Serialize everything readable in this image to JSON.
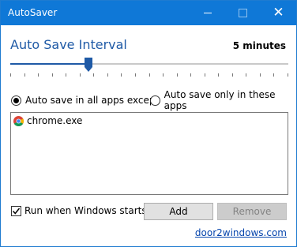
{
  "window": {
    "title": "AutoSaver",
    "controls": {
      "minimize_icon": "minimize-icon",
      "maximize_icon": "maximize-icon",
      "close_icon": "close-icon",
      "close_glyph": "✕"
    },
    "titlebar_color": "#0f78d7"
  },
  "interval": {
    "label": "Auto Save Interval",
    "value_text": "5 minutes",
    "slider": {
      "position_fraction": 0.28,
      "tick_count": 21,
      "accent": "#1f5aa6"
    }
  },
  "mode": {
    "options": [
      {
        "label": "Auto save in all apps except",
        "selected": true
      },
      {
        "label": "Auto save only in these apps",
        "selected": false
      }
    ]
  },
  "apps": {
    "items": [
      {
        "name": "chrome.exe",
        "icon": "chrome-icon"
      }
    ]
  },
  "startup": {
    "label": "Run when Windows starts",
    "checked": true
  },
  "buttons": {
    "add": "Add",
    "remove": "Remove"
  },
  "link": {
    "text": "door2windows.com"
  }
}
